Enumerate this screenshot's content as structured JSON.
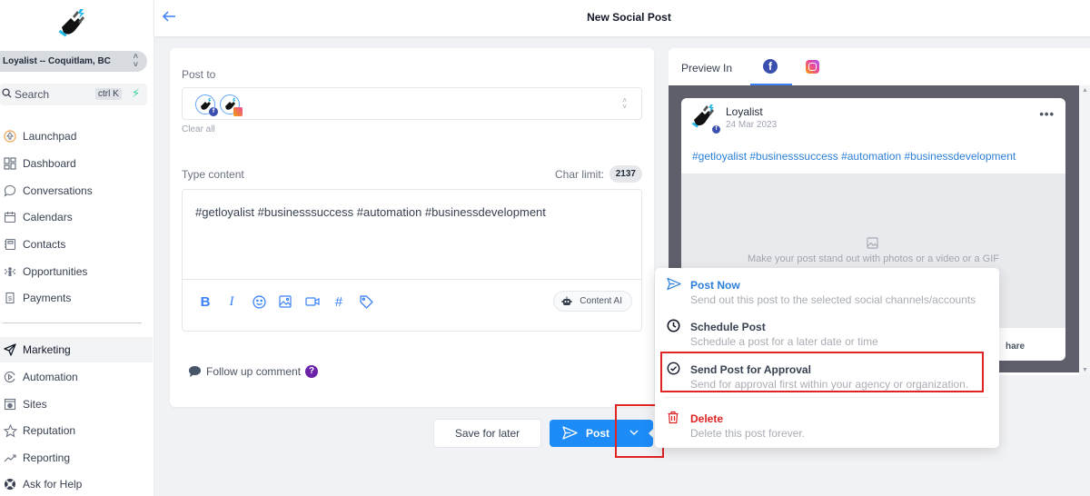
{
  "header": {
    "title": "New Social Post",
    "back_label": "←"
  },
  "sidebar": {
    "location": "Loyalist -- Coquitlam, BC",
    "search": {
      "label": "Search",
      "shortcut": "ctrl K"
    },
    "items": [
      {
        "label": "Launchpad",
        "icon": "rocket-icon"
      },
      {
        "label": "Dashboard",
        "icon": "grid-icon"
      },
      {
        "label": "Conversations",
        "icon": "chat-bubble-icon"
      },
      {
        "label": "Calendars",
        "icon": "calendar-icon"
      },
      {
        "label": "Contacts",
        "icon": "contact-book-icon"
      },
      {
        "label": "Opportunities",
        "icon": "funnel-icon"
      },
      {
        "label": "Payments",
        "icon": "payment-icon"
      },
      {
        "label": "Marketing",
        "icon": "send-icon",
        "active": true
      },
      {
        "label": "Automation",
        "icon": "play-icon"
      },
      {
        "label": "Sites",
        "icon": "globe-window-icon"
      },
      {
        "label": "Reputation",
        "icon": "star-icon"
      },
      {
        "label": "Reporting",
        "icon": "trend-icon"
      },
      {
        "label": "Ask for Help",
        "icon": "lifebuoy-icon"
      }
    ]
  },
  "editor": {
    "post_to_label": "Post to",
    "accounts": [
      {
        "network": "facebook",
        "badge_color": "#3b4fb0"
      },
      {
        "network": "instagram",
        "badge_color": "#ec4899"
      }
    ],
    "clear_all": "Clear all",
    "type_content_label": "Type content",
    "char_limit_label": "Char limit:",
    "char_limit_value": "2137",
    "content": "#getloyalist #businesssuccess #automation #businessdevelopment",
    "toolbar": [
      "bold",
      "italic",
      "emoji",
      "image",
      "video",
      "hashtag",
      "tag"
    ],
    "bold_glyph": "B",
    "italic_glyph": "I",
    "hashtag_glyph": "#",
    "content_ai_label": "Content AI",
    "follow_up_label": "Follow up comment",
    "help_glyph": "?"
  },
  "actions": {
    "save_later": "Save for later",
    "post": "Post"
  },
  "preview": {
    "label": "Preview In",
    "active_tab": "facebook",
    "page_name": "Loyalist",
    "date": "24 Mar 2023",
    "text": "#getloyalist #businesssuccess #automation #businessdevelopment",
    "media_placeholder": "Make your post stand out with photos or a video or a GIF",
    "share_label": "hare",
    "more_glyph": "•••"
  },
  "menu": {
    "items": [
      {
        "title": "Post Now",
        "desc": "Send out this post to the selected social channels/accounts",
        "color": "#2b7fd9"
      },
      {
        "title": "Schedule Post",
        "desc": "Schedule a post for a later date or time",
        "color": "#374151"
      },
      {
        "title": "Send Post for Approval",
        "desc": "Send for approval first within your agency or organization.",
        "color": "#374151",
        "highlighted": true
      },
      {
        "title": "Delete",
        "desc": "Delete this post forever.",
        "color": "#e02424"
      }
    ]
  },
  "colors": {
    "accent": "#1d8cf8",
    "highlight": "#e02424",
    "danger": "#e02424"
  }
}
